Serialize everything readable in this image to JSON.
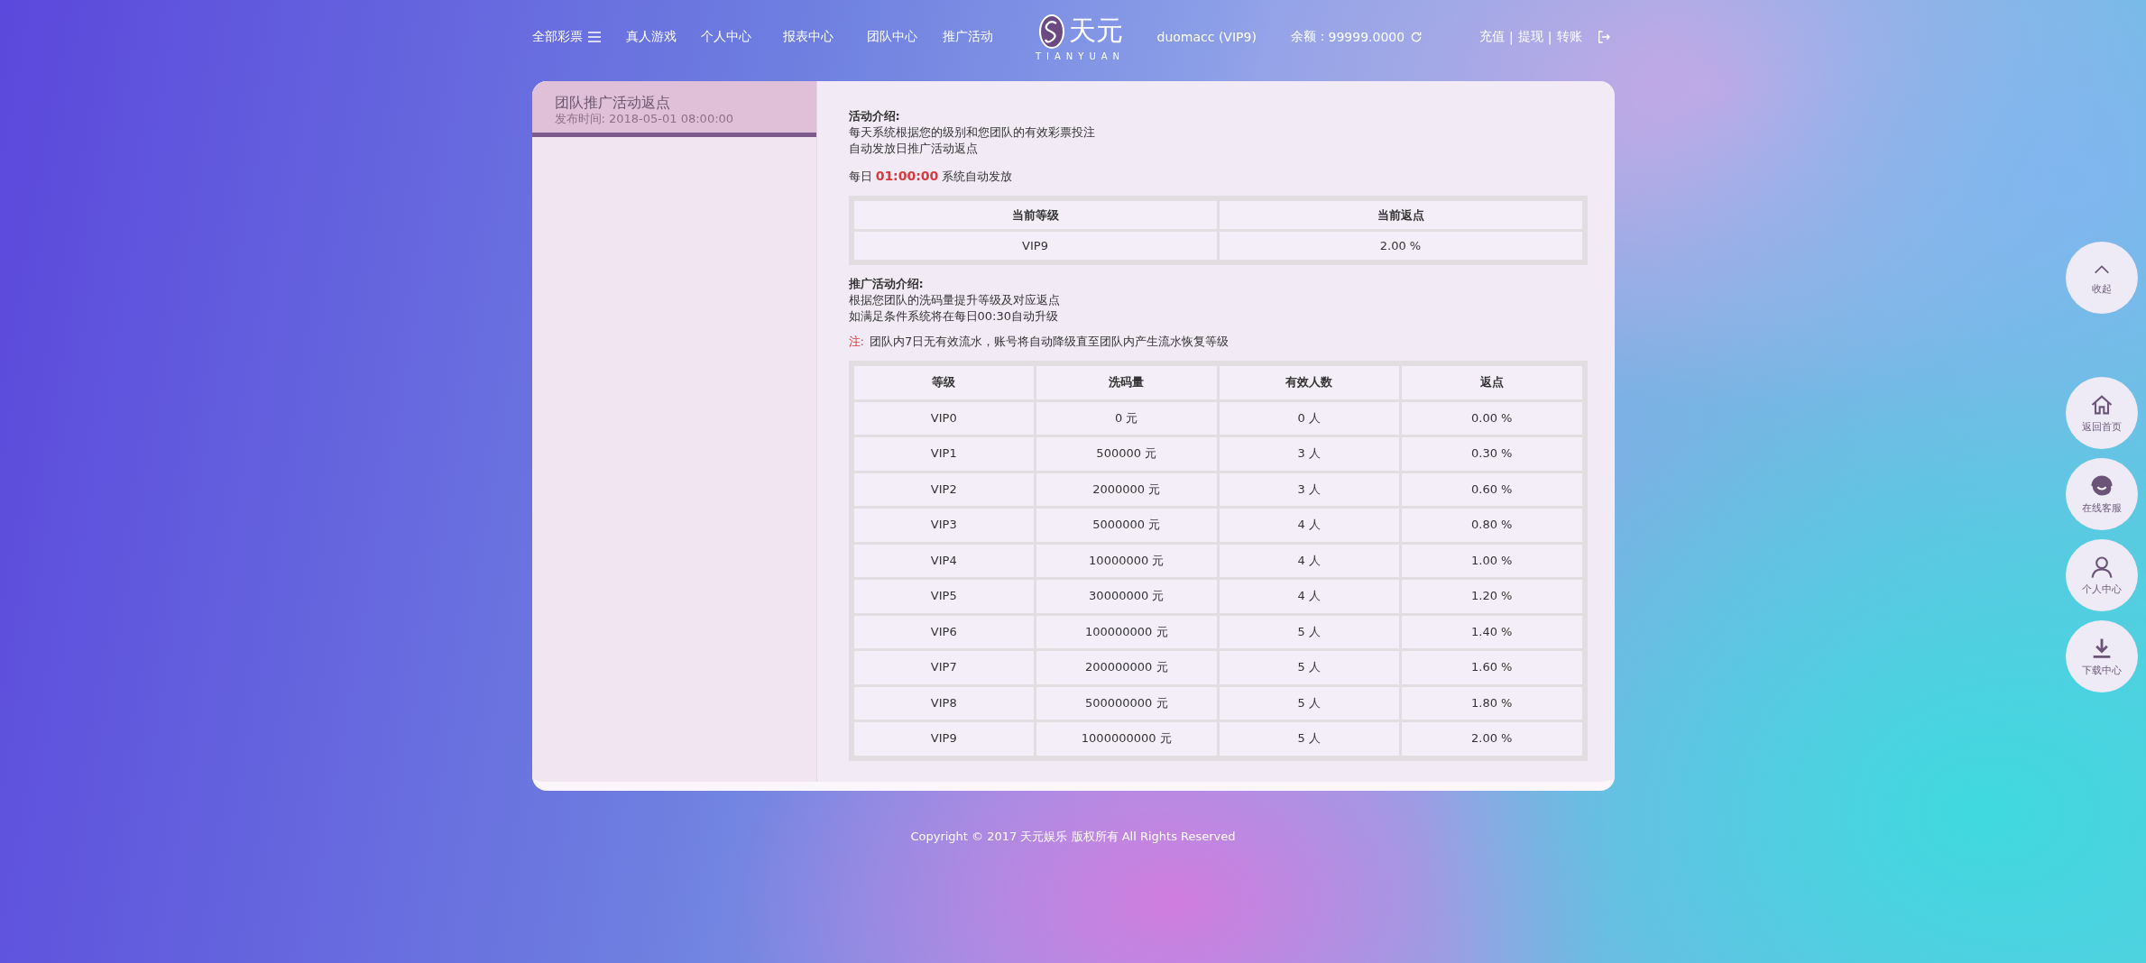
{
  "nav": {
    "menu_items": [
      {
        "label": "全部彩票",
        "kind": "menu"
      },
      {
        "label": "真人游戏",
        "kind": "link"
      },
      {
        "label": "个人中心",
        "kind": "link"
      },
      {
        "label": "报表中心",
        "kind": "link"
      },
      {
        "label": "团队中心",
        "kind": "link"
      },
      {
        "label": "推广活动",
        "kind": "link"
      }
    ],
    "logo": {
      "name": "天元",
      "sub": "TIANYUAN"
    },
    "user": "duomacc (VIP9)",
    "balance_label": "余额：",
    "balance": "99999.0000",
    "actions": [
      "充值",
      "提现",
      "转账"
    ],
    "separator": "|"
  },
  "sidebar": {
    "items": [
      {
        "title": "团队推广活动返点",
        "date": "发布时间: 2018-05-01 08:00:00",
        "selected": true
      }
    ]
  },
  "content": {
    "intro_title": "活动介绍:",
    "intro_lines": [
      "每天系统根据您的级别和您团队的有效彩票投注",
      "自动发放日推广活动返点"
    ],
    "schedule": "每日 **01:00:00** 系统自动发放",
    "current_table": {
      "columns": [
        "当前等级",
        "当前返点"
      ],
      "rows": [
        [
          "VIP9",
          "2.00 %"
        ]
      ]
    },
    "promo_title": "推广活动介绍:",
    "promo_lines": [
      "根据您团队的洗码量提升等级及对应返点",
      "如满足条件系统将在每日00:30自动升级"
    ],
    "note": {
      "label": "注:",
      "text": "团队内7日无有效流水，账号将自动降级直至团队内产生流水恢复等级"
    },
    "level_table": {
      "columns": [
        "等级",
        "洗码量",
        "有效人数",
        "返点"
      ],
      "rows": [
        [
          "VIP0",
          "0 元",
          "0 人",
          "0.00 %"
        ],
        [
          "VIP1",
          "500000 元",
          "3 人",
          "0.30 %"
        ],
        [
          "VIP2",
          "2000000 元",
          "3 人",
          "0.60 %"
        ],
        [
          "VIP3",
          "5000000 元",
          "4 人",
          "0.80 %"
        ],
        [
          "VIP4",
          "10000000 元",
          "4 人",
          "1.00 %"
        ],
        [
          "VIP5",
          "30000000 元",
          "4 人",
          "1.20 %"
        ],
        [
          "VIP6",
          "100000000 元",
          "5 人",
          "1.40 %"
        ],
        [
          "VIP7",
          "200000000 元",
          "5 人",
          "1.60 %"
        ],
        [
          "VIP8",
          "500000000 元",
          "5 人",
          "1.80 %"
        ],
        [
          "VIP9",
          "1000000000 元",
          "5 人",
          "2.00 %"
        ]
      ]
    }
  },
  "side_buttons": [
    {
      "label": "收起",
      "kind": "up"
    },
    {
      "label": "返回首页",
      "kind": "home"
    },
    {
      "label": "在线客服",
      "kind": "support"
    },
    {
      "label": "个人中心",
      "kind": "user"
    },
    {
      "label": "下载中心",
      "kind": "download"
    }
  ],
  "footer": "Copyright © 2017 天元娱乐 版权所有 All Rights Reserved"
}
